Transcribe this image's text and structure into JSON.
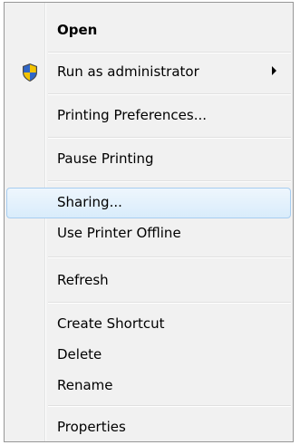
{
  "context_menu": {
    "items": [
      {
        "id": "open",
        "label": "Open",
        "bold": true
      },
      {
        "id": "run-as-admin",
        "label": "Run as administrator",
        "icon": "uac-shield-icon",
        "submenu": true
      },
      {
        "id": "printing-preferences",
        "label": "Printing Preferences..."
      },
      {
        "id": "pause-printing",
        "label": "Pause Printing"
      },
      {
        "id": "sharing",
        "label": "Sharing...",
        "highlighted": true
      },
      {
        "id": "use-printer-offline",
        "label": "Use Printer Offline"
      },
      {
        "id": "refresh",
        "label": "Refresh"
      },
      {
        "id": "create-shortcut",
        "label": "Create Shortcut"
      },
      {
        "id": "delete",
        "label": "Delete"
      },
      {
        "id": "rename",
        "label": "Rename"
      },
      {
        "id": "properties",
        "label": "Properties"
      }
    ]
  },
  "colors": {
    "menu_background": "#f1f1f1",
    "menu_border": "#979797",
    "highlight_fill": "#d9ecfb",
    "highlight_border": "#a7cdf0"
  }
}
